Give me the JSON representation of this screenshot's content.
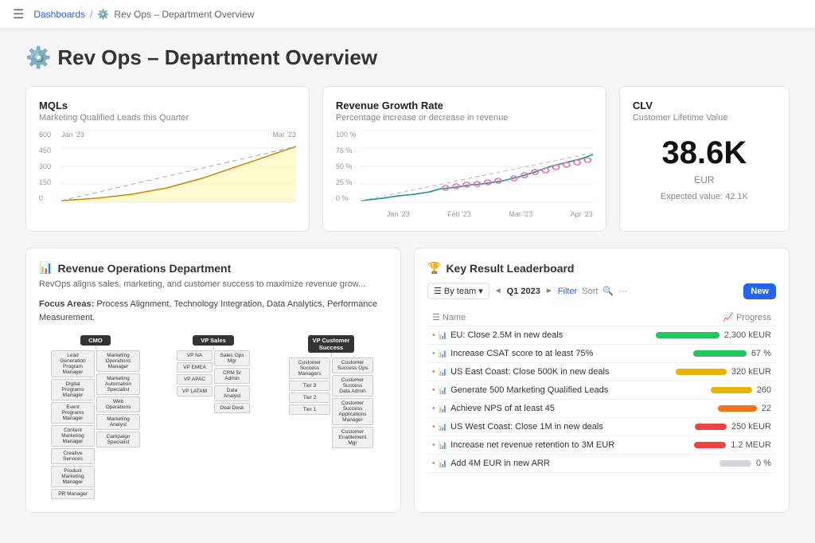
{
  "topbar": {
    "menu_icon": "☰",
    "breadcrumb_home": "Dashboards",
    "separator": "/",
    "current": "Rev Ops – Department Overview"
  },
  "page": {
    "icon": "⚙️",
    "title": "Rev Ops – Department Overview"
  },
  "mql_card": {
    "title": "MQLs",
    "subtitle": "Marketing Qualified Leads this Quarter",
    "y_labels": [
      "600",
      "450",
      "300",
      "150",
      "0"
    ],
    "x_labels": [
      "Jan '23",
      "Mar '23"
    ]
  },
  "revenue_card": {
    "title": "Revenue Growth Rate",
    "subtitle": "Percentage increase or decrease in revenue",
    "y_labels": [
      "100 %",
      "75 %",
      "50 %",
      "25 %",
      "0 %"
    ],
    "x_labels": [
      "Jan '23",
      "Feb '23",
      "Mar '23",
      "Apr '23"
    ]
  },
  "clv_card": {
    "title": "CLV",
    "subtitle": "Customer Lifetime Value",
    "value": "38.6K",
    "currency": "EUR",
    "expected_label": "Expected value: 42.1K"
  },
  "revenue_ops": {
    "icon": "📊",
    "title": "Revenue Operations Department",
    "description": "RevOps aligns sales, marketing, and customer success to maximize revenue grow...",
    "focus_label": "Focus Areas:",
    "focus_text": "Process Alignment, Technology Integration, Data Analytics, Performance Measurement."
  },
  "leaderboard": {
    "icon": "🏆",
    "title": "Key Result Leaderboard",
    "by_team_label": "By team",
    "quarter": "Q1 2023",
    "filter_label": "Filter",
    "sort_label": "Sort",
    "new_label": "New",
    "col_name": "Name",
    "col_progress": "Progress",
    "rows": [
      {
        "icon": "📊",
        "name": "EU: Close 2.5M in new deals",
        "progress_pct": 92,
        "progress_color": "green",
        "value": "2,300 kEUR"
      },
      {
        "icon": "📊",
        "name": "Increase CSAT score to at least 75%",
        "progress_pct": 67,
        "progress_color": "green",
        "value": "67 %"
      },
      {
        "icon": "📊",
        "name": "US East Coast: Close 500K in new deals",
        "progress_pct": 64,
        "progress_color": "yellow",
        "value": "320 kEUR"
      },
      {
        "icon": "📊",
        "name": "Generate 500 Marketing Qualified Leads",
        "progress_pct": 52,
        "progress_color": "yellow",
        "value": "260"
      },
      {
        "icon": "📊",
        "name": "Achieve NPS of at least 45",
        "progress_pct": 49,
        "progress_color": "orange",
        "value": "22"
      },
      {
        "icon": "📊",
        "name": "US West Coast: Close 1M in new deals",
        "progress_pct": 25,
        "progress_color": "red",
        "value": "250 kEUR"
      },
      {
        "icon": "📊",
        "name": "Increase net revenue retention to 3M EUR",
        "progress_pct": 40,
        "progress_color": "red",
        "value": "1.2 MEUR"
      },
      {
        "icon": "📊",
        "name": "Add 4M EUR in new ARR",
        "progress_pct": 0,
        "progress_color": "gray",
        "value": "0 %"
      }
    ]
  },
  "org": {
    "top_roles": [
      "CMO",
      "VP Sales",
      "VP Customer Success"
    ],
    "cmo_children": [
      "Lead Generation\nProgram Manager",
      "Marketing\nOperations Manager",
      "Digital Programs\nManager",
      "Marketing\nAutomation\nSpecialist",
      "Event Programs\nManager",
      "Web Operations",
      "Content Marketing\nManager",
      "Marketing Analyst",
      "Creative Services",
      "Campaign Specialist",
      "Product Marketing\nManager",
      "PR Manager"
    ],
    "vpsales_children": [
      "VP NA",
      "VP EMEA",
      "VP APAC",
      "VP LATAM",
      "Sales Ops\nMgr",
      "CRM Sr\nAdmin",
      "Data Analyst",
      "Deal Desk"
    ],
    "vpcustomer_children": [
      "Customer Success\nManagers",
      "Customer\nSuccess Ops",
      "Tier 3",
      "Tier 2",
      "Tier 1",
      "Customer Success\nData Admin",
      "Customer Success\nApplications\nManager",
      "Customer\nEnablement Mgr"
    ]
  }
}
